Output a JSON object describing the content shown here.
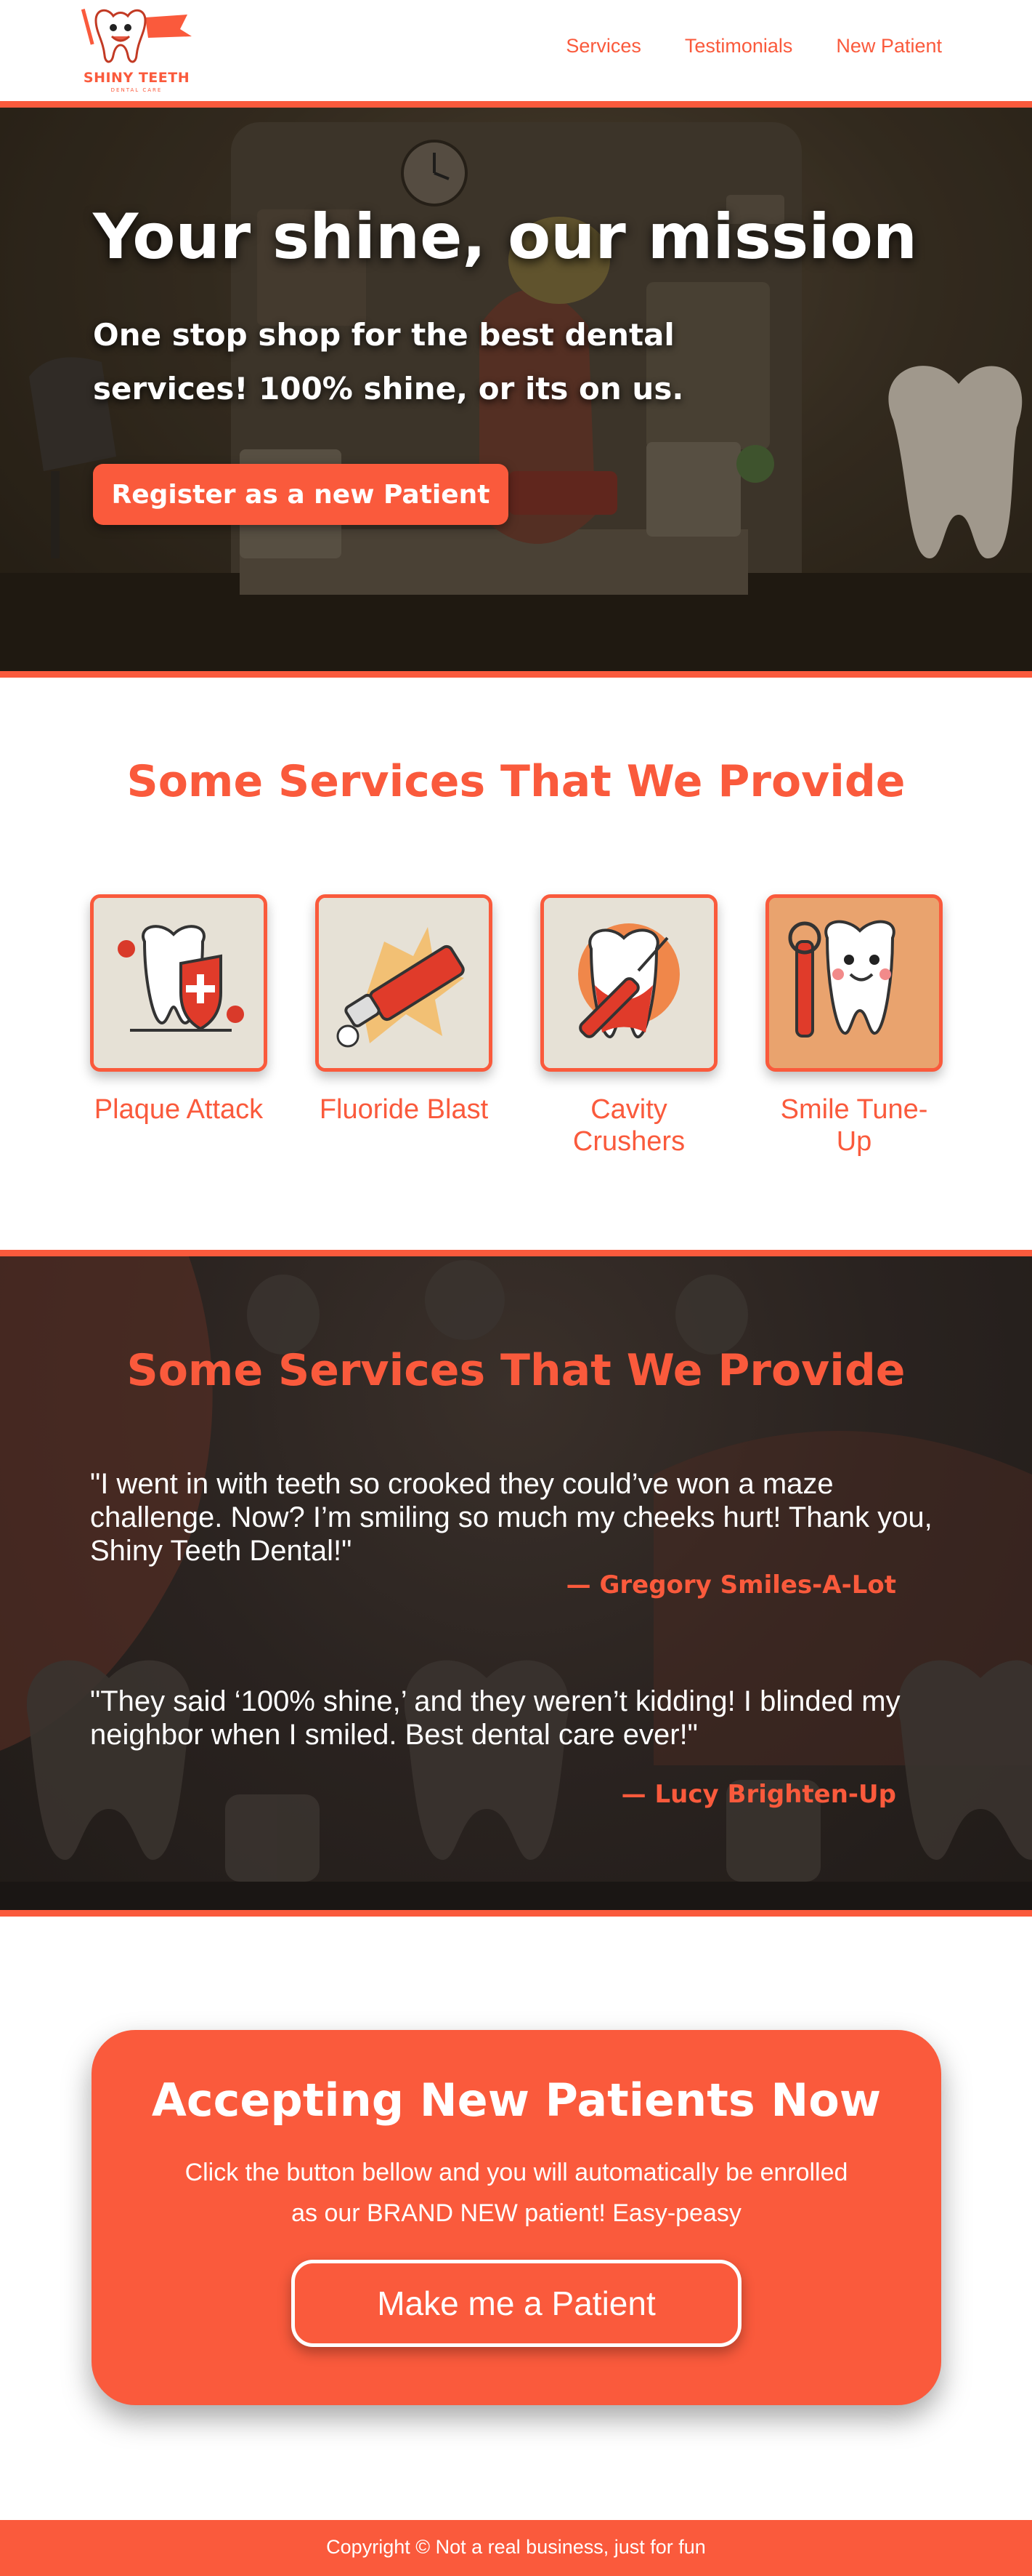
{
  "brand": {
    "name": "SHINY TEETH",
    "tagline": "DENTAL CARE",
    "accent": "#fa5a3c"
  },
  "nav": {
    "items": [
      "Services",
      "Testimonials",
      "New Patient"
    ]
  },
  "hero": {
    "title": "Your shine, our mission",
    "subtitle": "One stop shop for the best dental services! 100% shine, or its on us.",
    "button": "Register as a new Patient"
  },
  "services": {
    "title": "Some Services That We Provide",
    "items": [
      {
        "label": "Plaque Attack",
        "icon": "tooth-shield-icon"
      },
      {
        "label": "Fluoride Blast",
        "icon": "toothpaste-icon"
      },
      {
        "label": "Cavity Crushers",
        "icon": "tooth-drill-icon"
      },
      {
        "label": "Smile Tune-Up",
        "icon": "tooth-wrench-icon"
      }
    ]
  },
  "testimonials": {
    "title": "Some Services That We Provide",
    "items": [
      {
        "quote": "\"I went in with teeth so crooked they could’ve won a maze challenge. Now? I’m smiling so much my cheeks hurt! Thank you, Shiny Teeth Dental!\"",
        "author": "— Gregory Smiles-A-Lot"
      },
      {
        "quote": "\"They said ‘100% shine,’ and they weren’t kidding! I blinded my neighbor when I smiled. Best dental care ever!\"",
        "author": "— Lucy Brighten-Up"
      }
    ]
  },
  "cta": {
    "title": "Accepting New Patients Now",
    "text": "Click the button bellow and you will automatically be enrolled as our BRAND NEW patient! Easy-peasy",
    "button": "Make me a Patient"
  },
  "footer": {
    "text": "Copyright © Not a real business, just for fun"
  }
}
